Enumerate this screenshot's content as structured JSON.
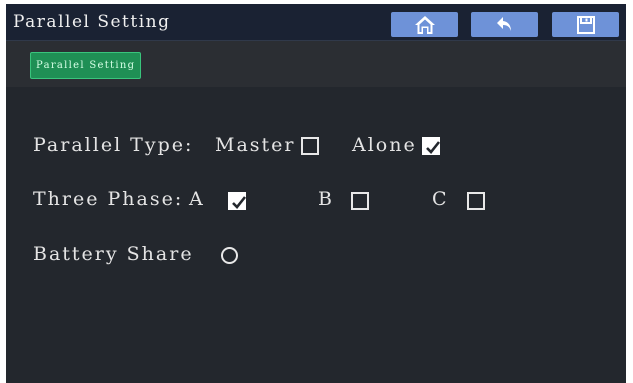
{
  "header": {
    "title": "Parallel Setting",
    "buttons": [
      {
        "icon": "home-icon"
      },
      {
        "icon": "back-arrow-icon"
      },
      {
        "icon": "save-icon"
      }
    ],
    "accent_color": "#6e92d8"
  },
  "tabs": [
    {
      "label": "Parallel Setting",
      "active": true,
      "color": "#1f8f55"
    }
  ],
  "settings": {
    "parallel_type_label": "Parallel Type:",
    "master_label": "Master",
    "master_checked": false,
    "alone_label": "Alone",
    "alone_checked": true,
    "three_phase_label": "Three Phase:",
    "phase_a_label": "A",
    "phase_a_checked": true,
    "phase_b_label": "B",
    "phase_b_checked": false,
    "phase_c_label": "C",
    "phase_c_checked": false,
    "battery_share_label": "Battery Share",
    "battery_share_selected": false
  }
}
